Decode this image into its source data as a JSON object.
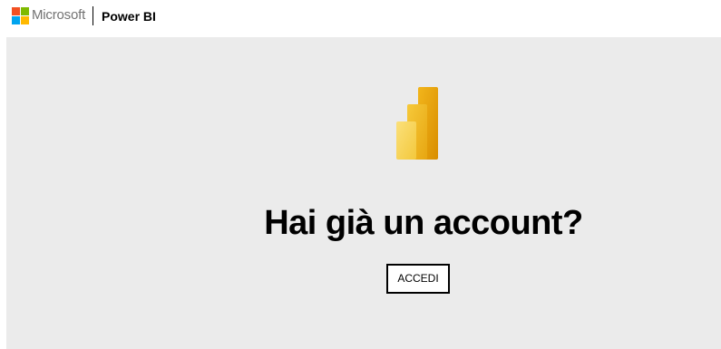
{
  "header": {
    "brand_logo_icon": "microsoft-logo-icon",
    "brand_name": "Microsoft",
    "product_name": "Power BI"
  },
  "hero": {
    "logo_icon": "power-bi-logo-icon",
    "title": "Hai già un account?",
    "signin_label": "ACCEDI"
  },
  "colors": {
    "hero_background": "#ebebeb",
    "pbi_yellow_light": "#f2c811",
    "pbi_yellow_dark": "#e8a200"
  }
}
